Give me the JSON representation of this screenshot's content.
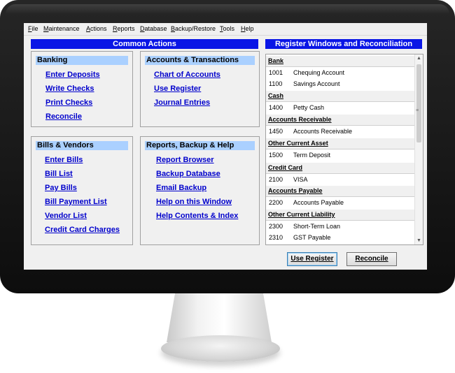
{
  "menu": [
    "File",
    "Maintenance",
    "Actions",
    "Reports",
    "Database",
    "Backup/Restore",
    "Tools",
    "Help"
  ],
  "common_actions": {
    "header": "Common Actions",
    "banking": {
      "title": "Banking",
      "links": [
        "Enter Deposits",
        "Write Checks",
        "Print Checks",
        "Reconcile"
      ]
    },
    "accounts": {
      "title": "Accounts & Transactions",
      "links": [
        "Chart of Accounts",
        "Use Register",
        "Journal Entries"
      ]
    },
    "bills": {
      "title": "Bills & Vendors",
      "links": [
        "Enter Bills",
        "Bill List",
        "Pay Bills",
        "Bill Payment List",
        "Vendor List",
        "Credit Card Charges"
      ]
    },
    "reports": {
      "title": "Reports, Backup & Help",
      "links": [
        "Report Browser",
        "Backup Database",
        "Email Backup",
        "Help on this Window",
        "Help Contents & Index"
      ]
    }
  },
  "register": {
    "header": "Register Windows and Reconciliation",
    "categories": [
      {
        "name": "Bank",
        "accounts": [
          {
            "code": "1001",
            "name": "Chequing Account"
          },
          {
            "code": "1100",
            "name": "Savings Account"
          }
        ]
      },
      {
        "name": "Cash",
        "accounts": [
          {
            "code": "1400",
            "name": "Petty Cash"
          }
        ]
      },
      {
        "name": "Accounts Receivable",
        "accounts": [
          {
            "code": "1450",
            "name": "Accounts Receivable"
          }
        ]
      },
      {
        "name": "Other Current Asset",
        "accounts": [
          {
            "code": "1500",
            "name": "Term Deposit"
          }
        ]
      },
      {
        "name": "Credit Card",
        "accounts": [
          {
            "code": "2100",
            "name": "VISA"
          }
        ]
      },
      {
        "name": "Accounts Payable",
        "accounts": [
          {
            "code": "2200",
            "name": "Accounts Payable"
          }
        ]
      },
      {
        "name": "Other Current Liability",
        "accounts": [
          {
            "code": "2300",
            "name": "Short-Term Loan"
          },
          {
            "code": "2310",
            "name": "GST Payable"
          }
        ]
      }
    ],
    "buttons": {
      "use_register": "Use Register",
      "reconcile": "Reconcile"
    }
  },
  "colors": {
    "header_bg": "#0a16e6",
    "group_title_bg": "#aad0ff",
    "link": "#0000cc"
  }
}
